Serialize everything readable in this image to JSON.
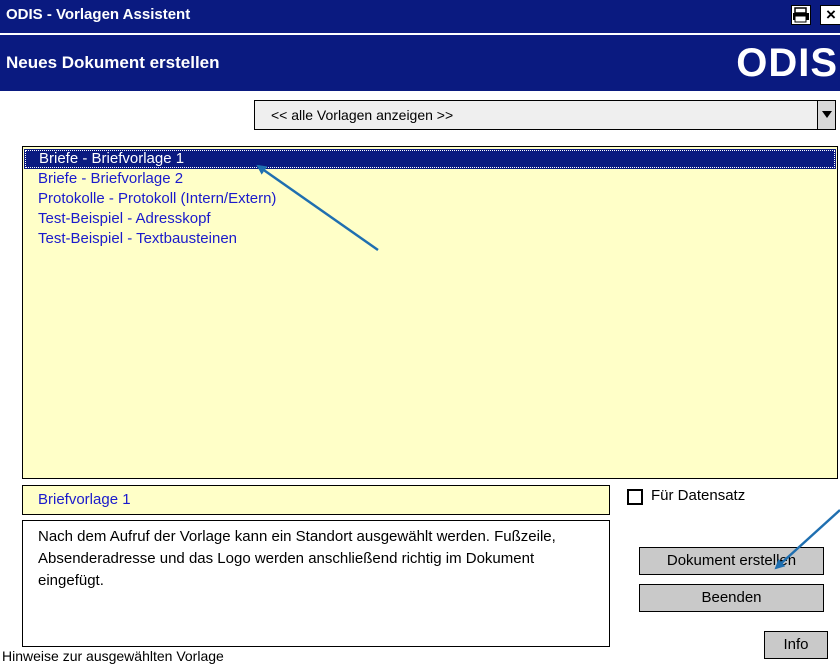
{
  "window": {
    "title": "ODIS  - Vorlagen Assistent",
    "close_label": "×"
  },
  "header": {
    "title": "Neues Dokument erstellen",
    "logo": "ODIS"
  },
  "filter": {
    "value": "<< alle Vorlagen anzeigen >>"
  },
  "templates": {
    "items": [
      {
        "label": "Briefe  -  Briefvorlage 1",
        "selected": true
      },
      {
        "label": "Briefe  -  Briefvorlage 2",
        "selected": false
      },
      {
        "label": "Protokolle  -  Protokoll (Intern/Extern)",
        "selected": false
      },
      {
        "label": "Test-Beispiel  -  Adresskopf",
        "selected": false
      },
      {
        "label": "Test-Beispiel  -  Textbausteinen",
        "selected": false
      }
    ]
  },
  "details": {
    "selected_name": "Briefvorlage 1",
    "description": "Nach dem Aufruf der Vorlage kann ein Standort ausgewählt werden. Fußzeile, Absenderadresse und das Logo werden anschließend richtig im Dokument eingefügt.",
    "hint_label": "Hinweise zur ausgewählten Vorlage"
  },
  "options": {
    "datensatz_label": "Für Datensatz",
    "datensatz_checked": false
  },
  "buttons": {
    "create": "Dokument erstellen",
    "quit": "Beenden",
    "info": "Info"
  },
  "colors": {
    "titlebar": "#0a1a80",
    "list_background": "#ffffc8",
    "list_text": "#1a1acc",
    "annotation_arrow": "#1f6fb0"
  },
  "icons": {
    "print": "printer-icon",
    "close": "close-icon",
    "dropdown": "chevron-down-icon"
  }
}
